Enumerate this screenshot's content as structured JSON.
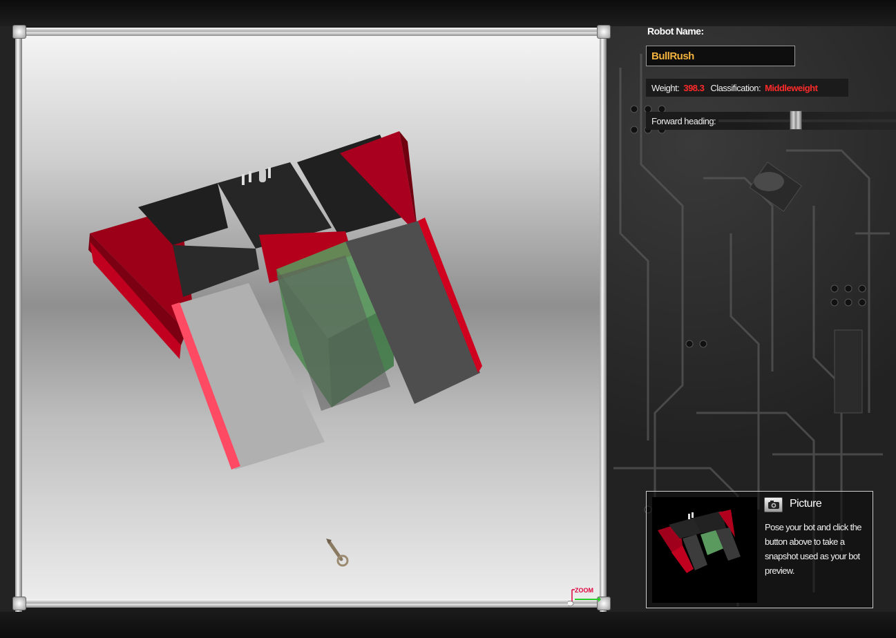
{
  "robot": {
    "name_label": "Robot Name:",
    "name_value": "BullRush"
  },
  "stats": {
    "weight_label": "Weight:",
    "weight_value": "398.3",
    "class_label": "Classification:",
    "class_value": "Middleweight"
  },
  "heading": {
    "label": "Forward heading:",
    "slider_level": 0.4
  },
  "picture": {
    "button_label": "Picture",
    "description": "Pose your bot and click the button above to take a snapshot used as your bot preview."
  },
  "viewport": {
    "zoom_label": "ZOOM"
  },
  "colors": {
    "accent_red": "#ff2a2a",
    "name_gold": "#f3b23d",
    "bot_red": "#a0001c",
    "bot_black": "#262626",
    "bot_green": "#5a9a5e"
  },
  "icons": {
    "camera": "camera-icon",
    "cursor": "wrench-cursor-icon",
    "zoom": "zoom-icon"
  }
}
